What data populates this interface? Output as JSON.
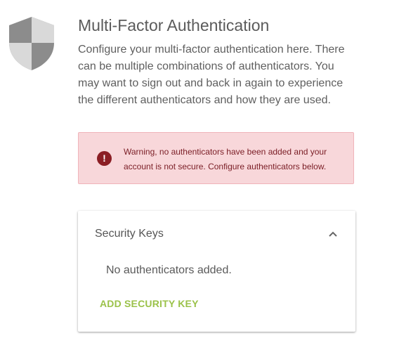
{
  "header": {
    "title": "Multi-Factor Authentication",
    "description": "Configure your multi-factor authentication here. There can be multiple combinations of authenticators. You may want to sign out and back in again to experience the different authenticators and how they are used."
  },
  "alert": {
    "icon": "exclamation-icon",
    "message": "Warning, no authenticators have been added and your account is not secure. Configure authenticators below."
  },
  "security_keys": {
    "title": "Security Keys",
    "expanded": true,
    "empty_message": "No authenticators added.",
    "add_label": "ADD SECURITY KEY"
  },
  "colors": {
    "alert_bg": "#f8d7da",
    "alert_text": "#7a1d25",
    "accent_green": "#9bc24a",
    "shield_gray": "#8c8c8c"
  }
}
